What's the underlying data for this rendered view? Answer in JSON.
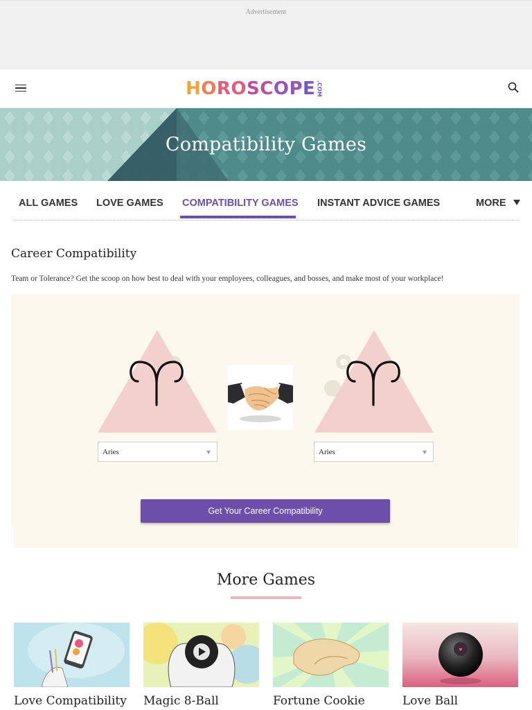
{
  "ad": {
    "label": "Advertisement"
  },
  "header": {
    "logo_letters": [
      "H",
      "O",
      "R",
      "O",
      "S",
      "C",
      "O",
      "P",
      "E"
    ],
    "logo_suffix": ".COM"
  },
  "banner": {
    "title": "Compatibility Games"
  },
  "tabs": [
    {
      "label": "ALL GAMES"
    },
    {
      "label": "LOVE GAMES"
    },
    {
      "label": "COMPATIBILITY GAMES",
      "active": true
    },
    {
      "label": "INSTANT ADVICE GAMES"
    },
    {
      "label": "MORE"
    }
  ],
  "game": {
    "title": "Career Compatibility",
    "description": "Team or Tolerance? Get the scoop on how best to deal with your employees, colleagues, and bosses, and make most of your workplace!",
    "left_sign": {
      "selected": "Aries",
      "icon": "aries-symbol-icon"
    },
    "right_sign": {
      "selected": "Aries",
      "icon": "aries-symbol-icon"
    },
    "center_icon": "handshake-icon",
    "cta_label": "Get Your Career Compatibility"
  },
  "more_games": {
    "title": "More Games",
    "cards": [
      {
        "title": "Love Compatibility"
      },
      {
        "title": "Magic 8-Ball"
      },
      {
        "title": "Fortune Cookie"
      },
      {
        "title": "Love Ball"
      }
    ]
  },
  "colors": {
    "accent": "#6b4fab",
    "panel_bg": "#fdf8ee",
    "triangle": "#f2d0cc",
    "banner_teal": "#4e8a8a",
    "underline_pink": "#e9b6bd"
  }
}
